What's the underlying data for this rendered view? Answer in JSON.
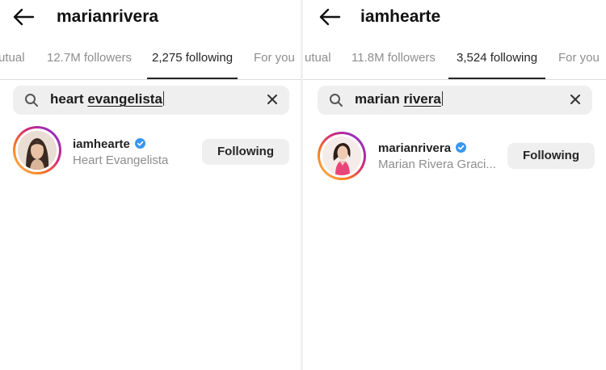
{
  "panels": [
    {
      "username": "marianrivera",
      "tabs": [
        {
          "label": "utual"
        },
        {
          "label": "12.7M followers"
        },
        {
          "label": "2,275 following",
          "active": true
        },
        {
          "label": "For you"
        }
      ],
      "search": {
        "word1": "heart",
        "word2": "evangelista"
      },
      "result": {
        "handle": "iamhearte",
        "fullname": "Heart Evangelista",
        "verified": true,
        "button": "Following"
      }
    },
    {
      "username": "iamhearte",
      "tabs": [
        {
          "label": "utual"
        },
        {
          "label": "11.8M followers"
        },
        {
          "label": "3,524 following",
          "active": true
        },
        {
          "label": "For you"
        }
      ],
      "search": {
        "word1": "marian",
        "word2": "rivera"
      },
      "result": {
        "handle": "marianrivera",
        "fullname": "Marian Rivera Graci...",
        "verified": true,
        "button": "Following"
      }
    }
  ],
  "colors": {
    "verified": "#3897f0",
    "muted": "#8e8e8e",
    "text": "#262626"
  },
  "icons": [
    "back-arrow-icon",
    "search-icon",
    "clear-icon",
    "verified-badge-icon"
  ]
}
